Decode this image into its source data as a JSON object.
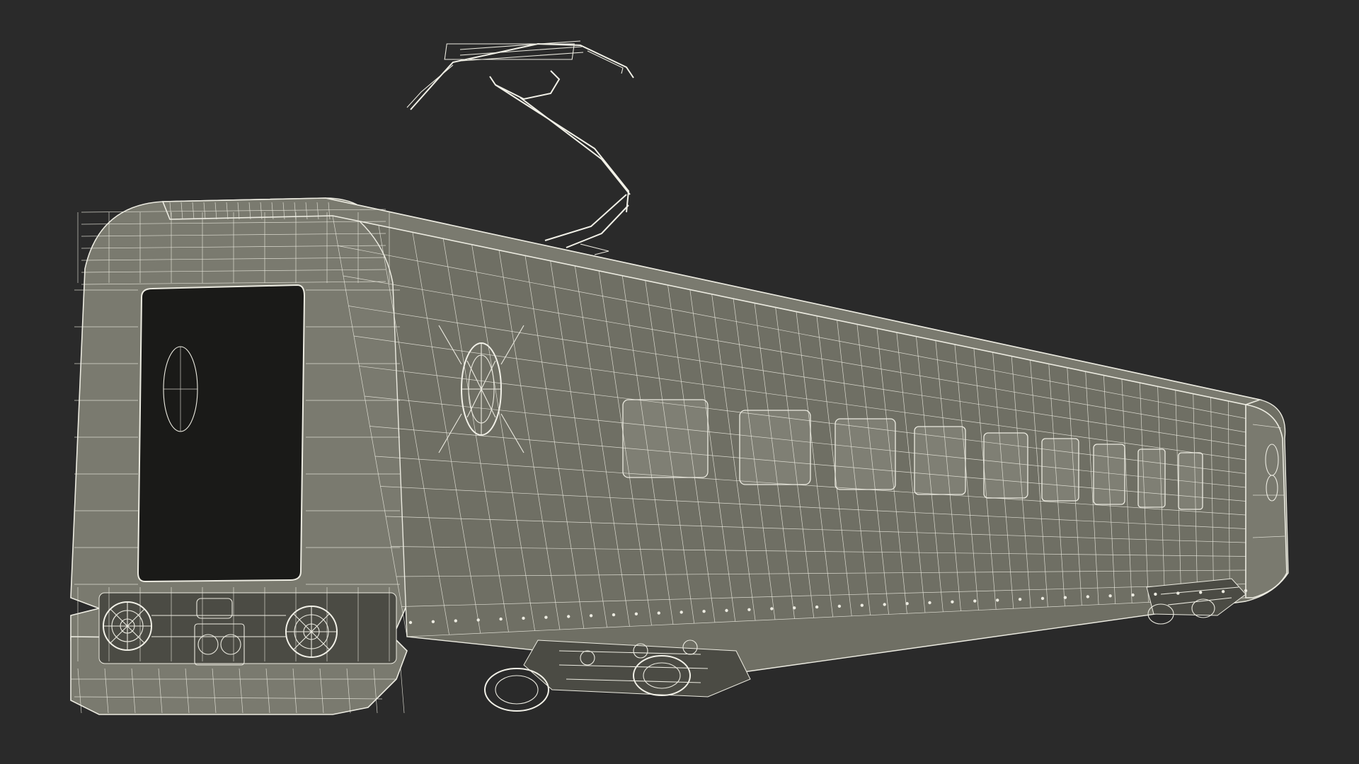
{
  "scene": {
    "subject": "tram-car-wireframe",
    "background_color": "#2a2a2a",
    "wire_color": "#ecebe1",
    "surface_color": "#7a7a6f"
  }
}
